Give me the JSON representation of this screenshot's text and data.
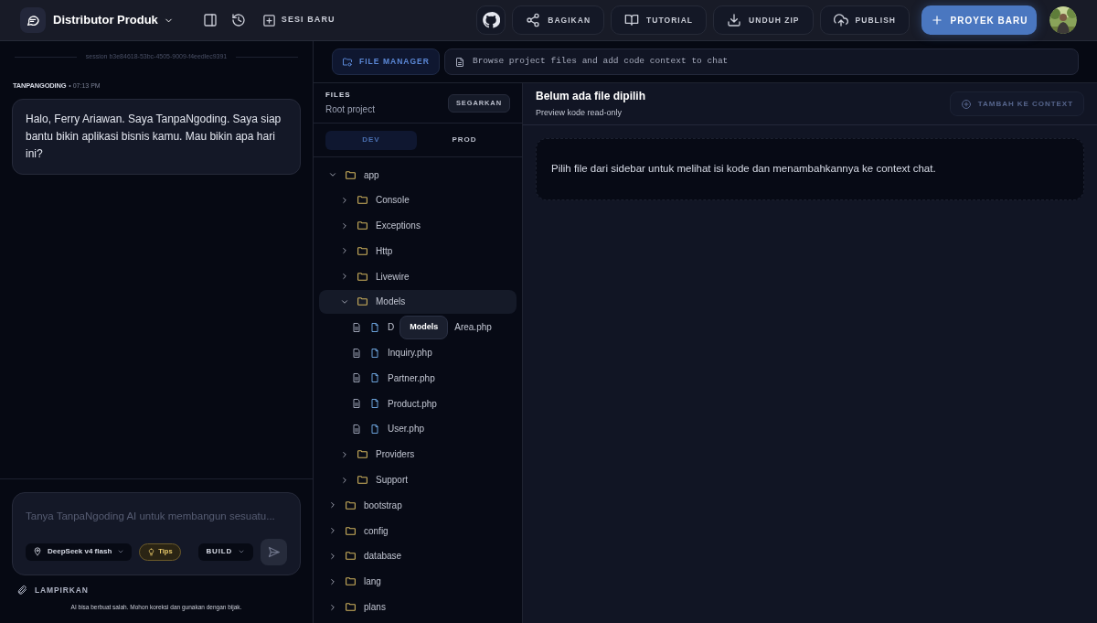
{
  "header": {
    "project": "Distributor Produk",
    "new_session": "SESI BARU",
    "actions": [
      {
        "kind": "github"
      },
      {
        "kind": "share",
        "label": "BAGIKAN"
      },
      {
        "kind": "book",
        "label": "TUTORIAL"
      },
      {
        "kind": "download",
        "label": "UNDUH ZIP"
      },
      {
        "kind": "upload",
        "label": "PUBLISH"
      }
    ],
    "primary": "PROYEK BARU"
  },
  "chat": {
    "session": "session b3e84618-53bc-4505-9009-f4eedlec9391",
    "sender": "TANPANGODING",
    "time": "• 07:13 PM",
    "message": "Halo, Ferry Ariawan. Saya TanpaNgoding. Saya siap bantu bikin aplikasi bisnis kamu. Mau bikin apa hari ini?",
    "placeholder": "Tanya TanpaNgoding AI untuk membangun sesuatu...",
    "model": "DeepSeek v4 flash",
    "tips": "Tips",
    "mode": "BUILD",
    "attach": "LAMPIRKAN",
    "disclaimer": "AI bisa berbuat salah. Mohon koreksi dan gunakan dengan bijak."
  },
  "file_manager": {
    "tab": "FILE MANAGER",
    "hint": "Browse project files and add code context to chat",
    "files_title": "FILES",
    "files_sub": "Root project",
    "refresh": "SEGARKAN",
    "envs": [
      {
        "label": "DEV",
        "selected": true
      },
      {
        "label": "PROD",
        "selected": false
      }
    ],
    "tree": [
      {
        "kind": "folder",
        "name": "app",
        "expanded": true,
        "hovered": false,
        "children": [
          {
            "kind": "folder",
            "name": "Console",
            "expanded": false,
            "hovered": false
          },
          {
            "kind": "folder",
            "name": "Exceptions",
            "expanded": false,
            "hovered": false
          },
          {
            "kind": "folder",
            "name": "Http",
            "expanded": false,
            "hovered": false
          },
          {
            "kind": "folder",
            "name": "Livewire",
            "expanded": false,
            "hovered": false
          },
          {
            "kind": "folder",
            "name": "Models",
            "expanded": true,
            "hovered": true,
            "tooltip": "Models",
            "children": [
              {
                "kind": "file",
                "name_parts": [
                  "D",
                  "Area.php"
                ]
              },
              {
                "kind": "file",
                "name": "Inquiry.php"
              },
              {
                "kind": "file",
                "name": "Partner.php"
              },
              {
                "kind": "file",
                "name": "Product.php"
              },
              {
                "kind": "file",
                "name": "User.php"
              }
            ]
          },
          {
            "kind": "folder",
            "name": "Providers",
            "expanded": false,
            "hovered": false
          },
          {
            "kind": "folder",
            "name": "Support",
            "expanded": false,
            "hovered": false
          }
        ]
      },
      {
        "kind": "folder",
        "name": "bootstrap",
        "expanded": false,
        "hovered": false
      },
      {
        "kind": "folder",
        "name": "config",
        "expanded": false,
        "hovered": false
      },
      {
        "kind": "folder",
        "name": "database",
        "expanded": false,
        "hovered": false
      },
      {
        "kind": "folder",
        "name": "lang",
        "expanded": false,
        "hovered": false
      },
      {
        "kind": "folder",
        "name": "plans",
        "expanded": false,
        "hovered": false
      }
    ],
    "preview_title": "Belum ada file dipilih",
    "preview_sub": "Preview kode read-only",
    "add_context": "TAMBAH KE CONTEXT",
    "add_context_disabled": true,
    "empty_message": "Pilih file dari sidebar untuk melihat isi kode dan menambahkannya ke context chat."
  }
}
